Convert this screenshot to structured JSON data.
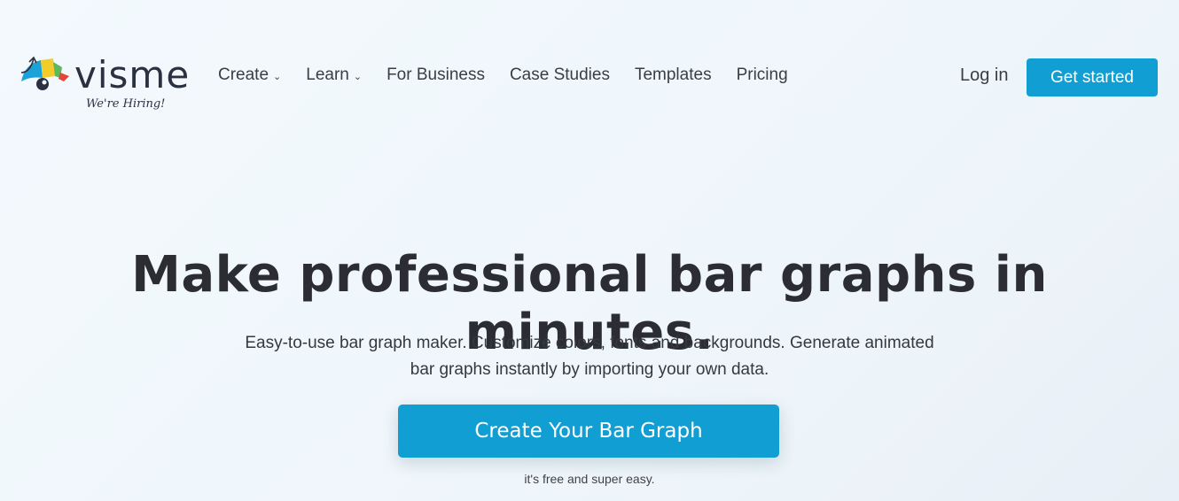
{
  "brand": {
    "name": "visme",
    "tagline": "We're Hiring!",
    "colors": {
      "primary": "#109ed3",
      "text": "#2b2d33"
    }
  },
  "nav": {
    "items": [
      {
        "label": "Create",
        "has_dropdown": true
      },
      {
        "label": "Learn",
        "has_dropdown": true
      },
      {
        "label": "For Business",
        "has_dropdown": false
      },
      {
        "label": "Case Studies",
        "has_dropdown": false
      },
      {
        "label": "Templates",
        "has_dropdown": false
      },
      {
        "label": "Pricing",
        "has_dropdown": false
      }
    ],
    "chevron": "⌄",
    "login": "Log in",
    "get_started": "Get started"
  },
  "hero": {
    "title": "Make professional bar graphs in minutes.",
    "subtitle": "Easy-to-use bar graph maker. Customize colors, fonts and backgrounds. Generate animated bar graphs instantly by importing your own data.",
    "cta": "Create Your Bar Graph",
    "cta_note": "it's free and super easy."
  }
}
